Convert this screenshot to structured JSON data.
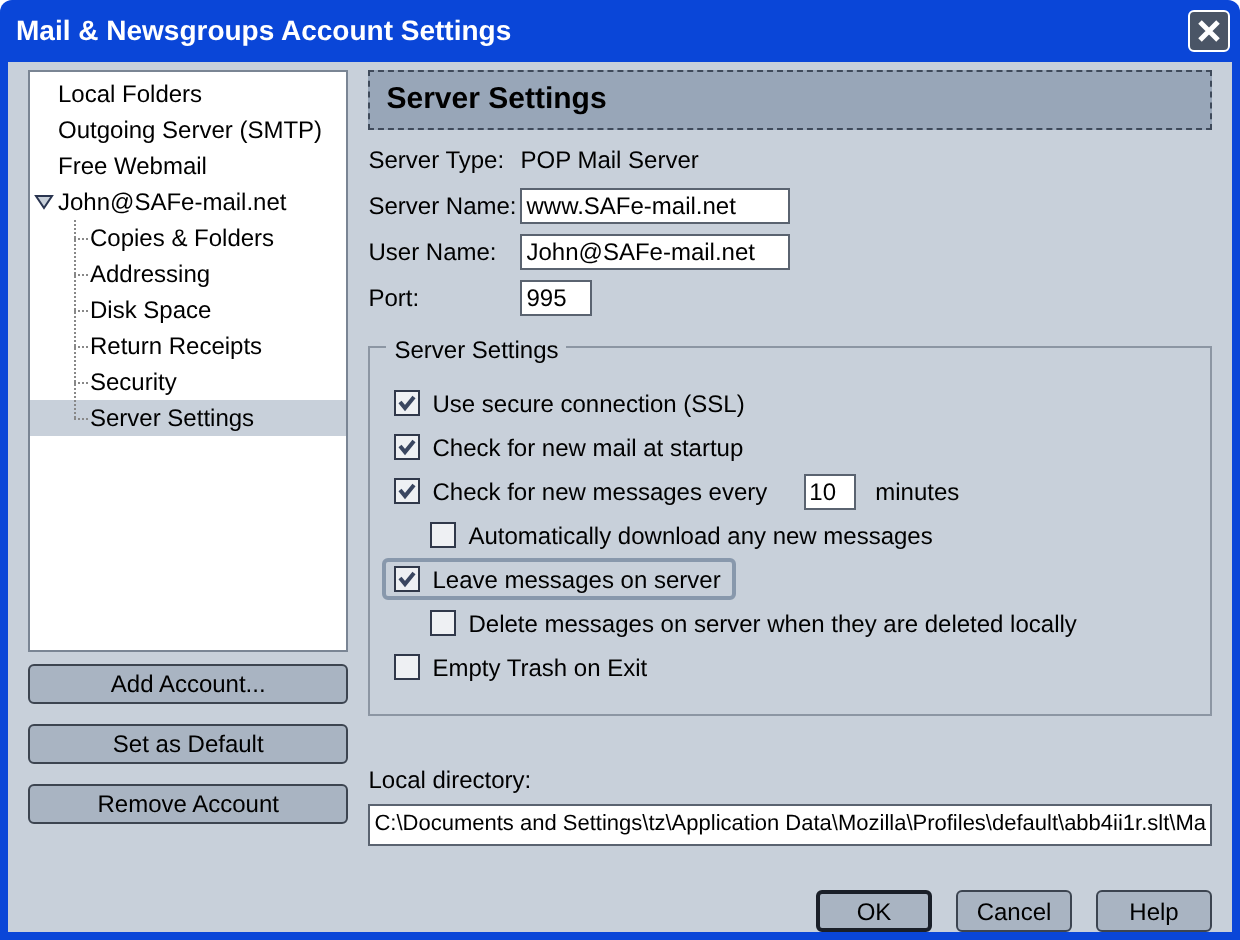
{
  "window": {
    "title": "Mail & Newsgroups Account Settings"
  },
  "tree": [
    {
      "label": "Local Folders",
      "selected": false
    },
    {
      "label": "Outgoing Server (SMTP)",
      "selected": false
    },
    {
      "label": "Free Webmail",
      "selected": false
    },
    {
      "label": "John@SAFe-mail.net",
      "selected": false,
      "expanded": true,
      "children": [
        {
          "label": "Copies & Folders",
          "selected": false
        },
        {
          "label": "Addressing",
          "selected": false
        },
        {
          "label": "Disk Space",
          "selected": false
        },
        {
          "label": "Return Receipts",
          "selected": false
        },
        {
          "label": "Security",
          "selected": false
        },
        {
          "label": "Server Settings",
          "selected": true
        }
      ]
    }
  ],
  "account_buttons": [
    "Add Account...",
    "Set as Default",
    "Remove Account"
  ],
  "header": "Server Settings",
  "fields": [
    {
      "kind": "text",
      "label": "Server Type:",
      "value": "POP Mail Server"
    },
    {
      "kind": "input",
      "label": "Server Name:",
      "value": "www.SAFe-mail.net"
    },
    {
      "kind": "input",
      "label": "User Name:",
      "value": "John@SAFe-mail.net"
    },
    {
      "kind": "port",
      "label": "Port:",
      "value": "995"
    }
  ],
  "group": {
    "title": "Server Settings",
    "options": [
      {
        "label": "Use secure connection (SSL)",
        "checked": true,
        "focused": false
      },
      {
        "label": "Check for new mail at startup",
        "checked": true,
        "focused": false
      },
      {
        "label": "Check for new messages every",
        "checked": true,
        "focused": false,
        "input": "10",
        "suffix": "minutes",
        "children": [
          {
            "label": "Automatically download any new messages",
            "checked": false,
            "focused": false
          }
        ]
      },
      {
        "label": "Leave messages on server",
        "checked": true,
        "focused": true,
        "children": [
          {
            "label": "Delete messages on server when they are deleted locally",
            "checked": false,
            "focused": false
          }
        ]
      },
      {
        "label": "Empty Trash on Exit",
        "checked": false,
        "focused": false
      }
    ]
  },
  "local_directory": {
    "label": "Local directory:",
    "value": "C:\\Documents and Settings\\tz\\Application Data\\Mozilla\\Profiles\\default\\abb4ii1r.slt\\Ma"
  },
  "buttons": [
    {
      "label": "OK",
      "default": true
    },
    {
      "label": "Cancel",
      "default": false
    },
    {
      "label": "Help",
      "default": false
    }
  ]
}
